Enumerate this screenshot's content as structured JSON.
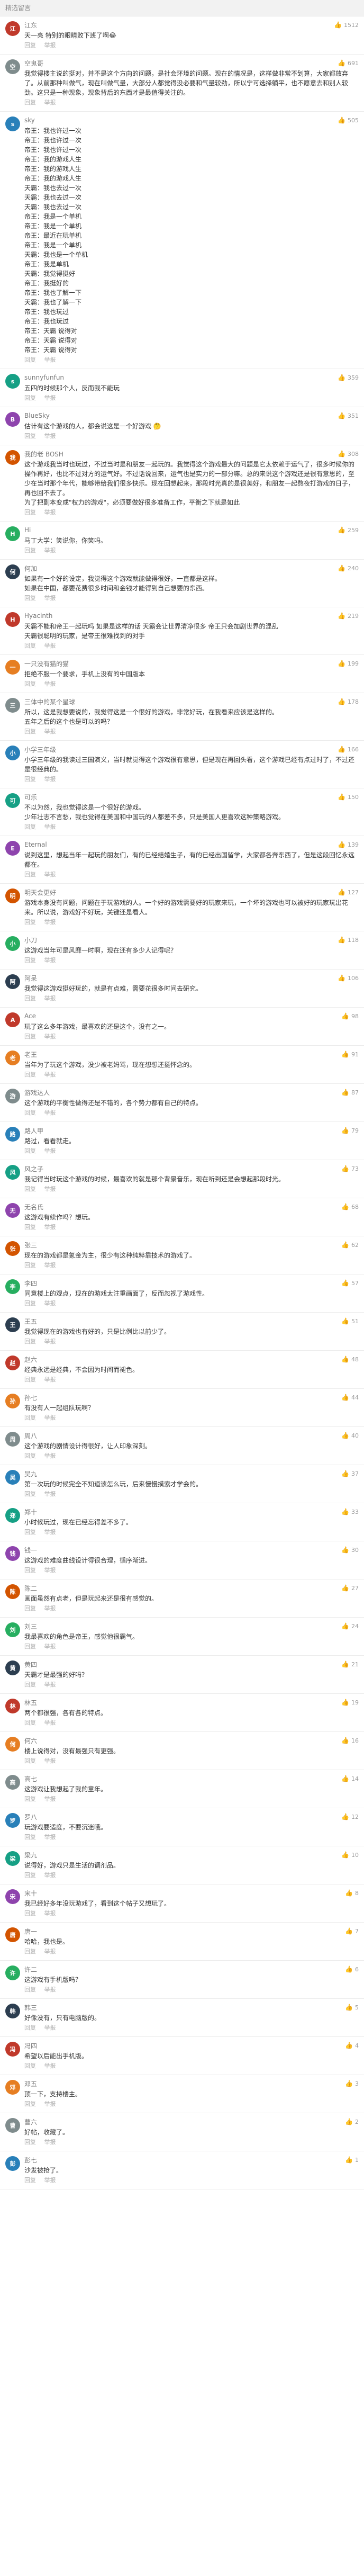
{
  "page": {
    "header": "精选留言"
  },
  "reply_label": "回复",
  "report_label": "举报",
  "comments": [
    {
      "user": "江东",
      "likes": "1512",
      "color": "#c0392b",
      "text": "天一亮 特别的眼睛败下班了啊😂"
    },
    {
      "user": "空鬼哥",
      "likes": "691",
      "color": "#7f8c8d",
      "text": "我觉得楼主说的挺对，并不是这个方向的问题，是社会环境的问题。现在的情况是，这样做非常不划算，大家都放弃了。从前那种叫做气，现在叫做气量，大部分人都觉得没必要和气量较劲，所以宁可选择躺平，也不愿意去和别人较劲。这只是一种现象，现象背后的东西才是最值得关注的。"
    },
    {
      "user": "sky",
      "likes": "505",
      "color": "#2980b9",
      "text": "帝王：我也许过一次\n帝王：我也许过一次\n帝王：我也许过一次\n帝王：我的游戏人生\n帝王：我的游戏人生\n帝王：我的游戏人生\n天霸：我也去过一次\n天霸：我也去过一次\n天霸：我也去过一次\n帝王：我是一个单机\n帝王：我是一个单机\n帝王：最近在玩单机\n帝王：我是一个单机\n天霸：我也是一个单机\n帝王：我是单机\n天霸：我觉得挺好\n帝王：我挺好的\n帝王：我也了解一下\n天霸：我也了解一下\n帝王：我也玩过\n帝王：我也玩过\n帝王：天霸 说得对\n帝王：天霸 说得对\n帝王：天霸 说得对"
    },
    {
      "user": "sunnyfunfun",
      "likes": "359",
      "color": "#16a085",
      "text": "五四的时候那个人，反而我不能玩"
    },
    {
      "user": "BlueSky",
      "likes": "351",
      "color": "#8e44ad",
      "text": "估计有这个游戏的人，都会说这是一个好游戏 🤔"
    },
    {
      "user": "我的老 BOSH",
      "likes": "308",
      "color": "#d35400",
      "text": "这个游戏我当时也玩过，不过当时是和朋友一起玩的。我觉得这个游戏最大的问题是它太依赖于运气了，很多时候你的操作再好，也比不过对方的运气好。不过话说回来，运气也是实力的一部分嘛。总的来说这个游戏还是很有意思的，至少在当时那个年代，能够带给我们很多快乐。现在回想起来，那段时光真的是很美好，和朋友一起熬夜打游戏的日子，再也回不去了。\n为了把副本变成\"权力的游戏\"，必须要做好很多准备工作，平衡之下就是如此"
    },
    {
      "user": "Hi",
      "likes": "259",
      "color": "#27ae60",
      "text": "马丁大学：笑说你，你笑吗。"
    },
    {
      "user": "何加",
      "likes": "240",
      "color": "#2c3e50",
      "text": "如果有一个好的设定，我觉得这个游戏就能做得很好，一直都是这样。\n如果在中国，都要花费很多时间和金钱才能得到自己想要的东西。"
    },
    {
      "user": "Hyacinth",
      "likes": "219",
      "color": "#c0392b",
      "text": "天霸不能和帝王一起玩吗 如果是这样的话 天霸会让世界清净很多 帝王只会加剧世界的混乱\n天霸很聪明的玩家，是帝王很难找到的对手"
    },
    {
      "user": "一只没有猫的猫",
      "likes": "199",
      "color": "#e67e22",
      "text": "拒绝不服一个要求，手机上没有的中国版本"
    },
    {
      "user": "三体中的某个星球",
      "likes": "178",
      "color": "#7f8c8d",
      "text": "所以，这是我想要说的，我觉得这是一个很好的游戏，非常好玩，在我看来应该是这样的。\n五年之后的这个也是可以的吗？"
    },
    {
      "user": "小学三年级",
      "likes": "166",
      "color": "#2980b9",
      "text": "小学三年级的我读过三国演义，当时就觉得这个游戏很有意思，但是现在再回头看，这个游戏已经有点过时了，不过还是很经典的。"
    },
    {
      "user": "可乐",
      "likes": "150",
      "color": "#16a085",
      "text": "不以为然，我也觉得这是一个很好的游戏。\n少年壮志不言愁，我也觉得在美国和中国玩的人都差不多，只是美国人更喜欢这种策略游戏。"
    },
    {
      "user": "Eternal",
      "likes": "139",
      "color": "#8e44ad",
      "text": "说到这里，想起当年一起玩的朋友们，有的已经结婚生子，有的已经出国留学，大家都各奔东西了，但是这段回忆永远都在。"
    },
    {
      "user": "明天会更好",
      "likes": "127",
      "color": "#d35400",
      "text": "游戏本身没有问题，问题在于玩游戏的人。一个好的游戏需要好的玩家来玩，一个坏的游戏也可以被好的玩家玩出花来。所以说，游戏好不好玩，关键还是看人。"
    },
    {
      "user": "小刀",
      "likes": "118",
      "color": "#27ae60",
      "text": "这游戏当年可是风靡一时啊，现在还有多少人记得呢？"
    },
    {
      "user": "阿呆",
      "likes": "106",
      "color": "#2c3e50",
      "text": "我觉得这游戏挺好玩的，就是有点难，需要花很多时间去研究。"
    },
    {
      "user": "Ace",
      "likes": "98",
      "color": "#c0392b",
      "text": "玩了这么多年游戏，最喜欢的还是这个，没有之一。"
    },
    {
      "user": "老王",
      "likes": "91",
      "color": "#e67e22",
      "text": "当年为了玩这个游戏，没少被老妈骂，现在想想还挺怀念的。"
    },
    {
      "user": "游戏达人",
      "likes": "87",
      "color": "#7f8c8d",
      "text": "这个游戏的平衡性做得还是不错的，各个势力都有自己的特点。"
    },
    {
      "user": "路人甲",
      "likes": "79",
      "color": "#2980b9",
      "text": "路过，看看就走。"
    },
    {
      "user": "风之子",
      "likes": "73",
      "color": "#16a085",
      "text": "我记得当时玩这个游戏的时候，最喜欢的就是那个背景音乐，现在听到还是会想起那段时光。"
    },
    {
      "user": "无名氏",
      "likes": "68",
      "color": "#8e44ad",
      "text": "这游戏有续作吗？想玩。"
    },
    {
      "user": "张三",
      "likes": "62",
      "color": "#d35400",
      "text": "现在的游戏都是氪金为主，很少有这种纯粹靠技术的游戏了。"
    },
    {
      "user": "李四",
      "likes": "57",
      "color": "#27ae60",
      "text": "同意楼上的观点，现在的游戏太注重画面了，反而忽视了游戏性。"
    },
    {
      "user": "王五",
      "likes": "51",
      "color": "#2c3e50",
      "text": "我觉得现在的游戏也有好的，只是比例比以前少了。"
    },
    {
      "user": "赵六",
      "likes": "48",
      "color": "#c0392b",
      "text": "经典永远是经典，不会因为时间而褪色。"
    },
    {
      "user": "孙七",
      "likes": "44",
      "color": "#e67e22",
      "text": "有没有人一起组队玩啊？"
    },
    {
      "user": "周八",
      "likes": "40",
      "color": "#7f8c8d",
      "text": "这个游戏的剧情设计得很好，让人印象深刻。"
    },
    {
      "user": "吴九",
      "likes": "37",
      "color": "#2980b9",
      "text": "第一次玩的时候完全不知道该怎么玩，后来慢慢摸索才学会的。"
    },
    {
      "user": "郑十",
      "likes": "33",
      "color": "#16a085",
      "text": "小时候玩过，现在已经忘得差不多了。"
    },
    {
      "user": "钱一",
      "likes": "30",
      "color": "#8e44ad",
      "text": "这游戏的难度曲线设计得很合理，循序渐进。"
    },
    {
      "user": "陈二",
      "likes": "27",
      "color": "#d35400",
      "text": "画面虽然有点老，但是玩起来还是很有感觉的。"
    },
    {
      "user": "刘三",
      "likes": "24",
      "color": "#27ae60",
      "text": "我最喜欢的角色是帝王，感觉他很霸气。"
    },
    {
      "user": "黄四",
      "likes": "21",
      "color": "#2c3e50",
      "text": "天霸才是最强的好吗？"
    },
    {
      "user": "林五",
      "likes": "19",
      "color": "#c0392b",
      "text": "两个都很强，各有各的特点。"
    },
    {
      "user": "何六",
      "likes": "16",
      "color": "#e67e22",
      "text": "楼上说得对，没有最强只有更强。"
    },
    {
      "user": "高七",
      "likes": "14",
      "color": "#7f8c8d",
      "text": "这游戏让我想起了我的童年。"
    },
    {
      "user": "罗八",
      "likes": "12",
      "color": "#2980b9",
      "text": "玩游戏要适度，不要沉迷哦。"
    },
    {
      "user": "梁九",
      "likes": "10",
      "color": "#16a085",
      "text": "说得好，游戏只是生活的调剂品。"
    },
    {
      "user": "宋十",
      "likes": "8",
      "color": "#8e44ad",
      "text": "我已经好多年没玩游戏了，看到这个帖子又想玩了。"
    },
    {
      "user": "唐一",
      "likes": "7",
      "color": "#d35400",
      "text": "哈哈，我也是。"
    },
    {
      "user": "许二",
      "likes": "6",
      "color": "#27ae60",
      "text": "这游戏有手机版吗？"
    },
    {
      "user": "韩三",
      "likes": "5",
      "color": "#2c3e50",
      "text": "好像没有，只有电脑版的。"
    },
    {
      "user": "冯四",
      "likes": "4",
      "color": "#c0392b",
      "text": "希望以后能出手机版。"
    },
    {
      "user": "邓五",
      "likes": "3",
      "color": "#e67e22",
      "text": "顶一下，支持楼主。"
    },
    {
      "user": "曹六",
      "likes": "2",
      "color": "#7f8c8d",
      "text": "好帖，收藏了。"
    },
    {
      "user": "彭七",
      "likes": "1",
      "color": "#2980b9",
      "text": "沙发被抢了。"
    }
  ]
}
